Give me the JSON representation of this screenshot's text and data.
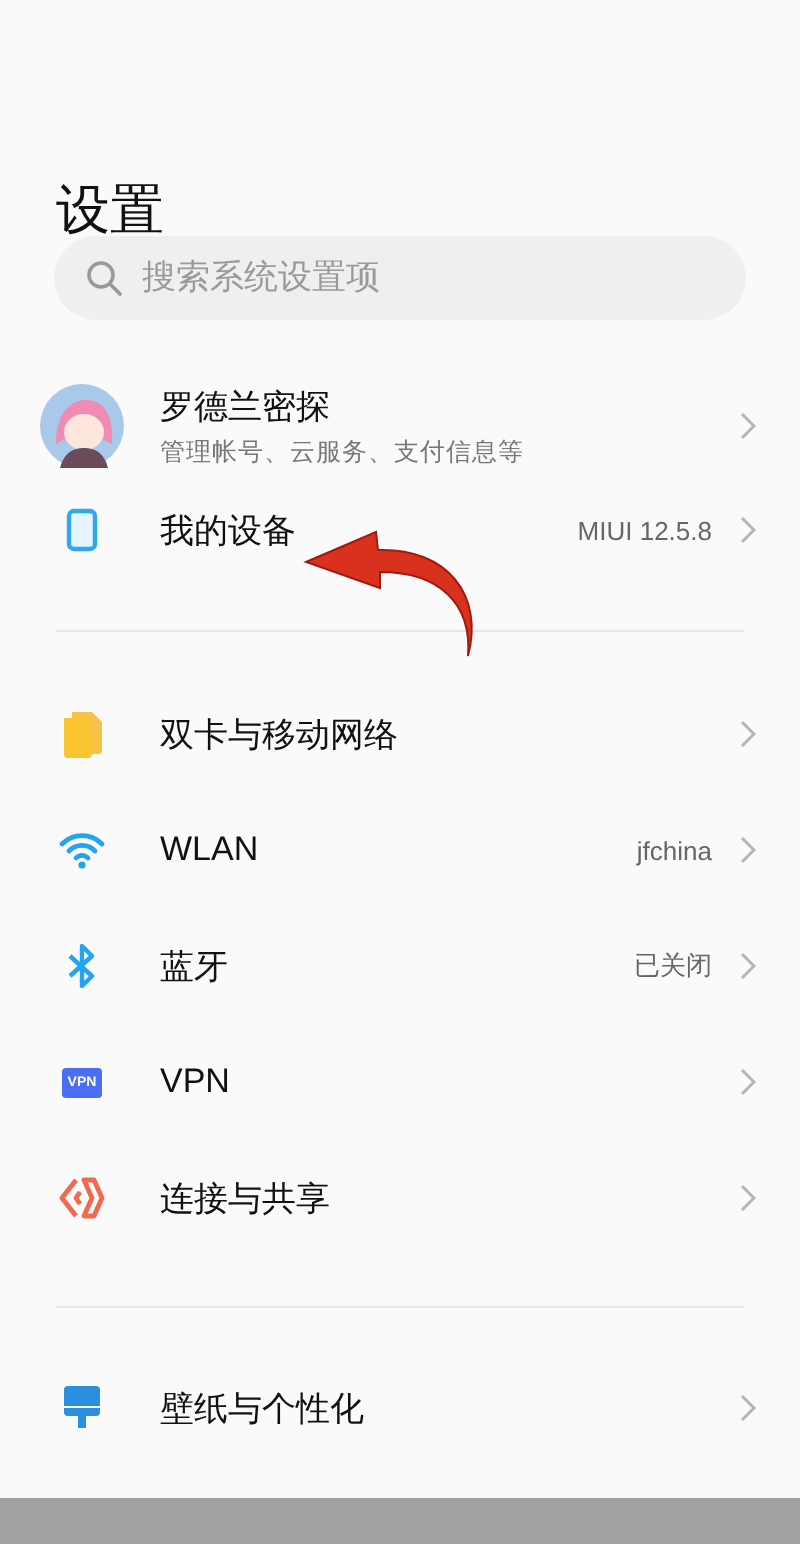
{
  "title": "设置",
  "search": {
    "placeholder": "搜索系统设置项"
  },
  "account": {
    "name": "罗德兰密探",
    "subtitle": "管理帐号、云服务、支付信息等"
  },
  "sections": [
    {
      "items": [
        {
          "kind": "device",
          "label": "我的设备",
          "value": "MIUI 12.5.8"
        }
      ]
    },
    {
      "items": [
        {
          "kind": "sim",
          "label": "双卡与移动网络"
        },
        {
          "kind": "wifi",
          "label": "WLAN",
          "value": "jfchina"
        },
        {
          "kind": "bluetooth",
          "label": "蓝牙",
          "value": "已关闭"
        },
        {
          "kind": "vpn",
          "label": "VPN",
          "badge": "VPN"
        },
        {
          "kind": "share",
          "label": "连接与共享"
        }
      ]
    },
    {
      "items": [
        {
          "kind": "wallpaper",
          "label": "壁纸与个性化"
        }
      ]
    }
  ]
}
